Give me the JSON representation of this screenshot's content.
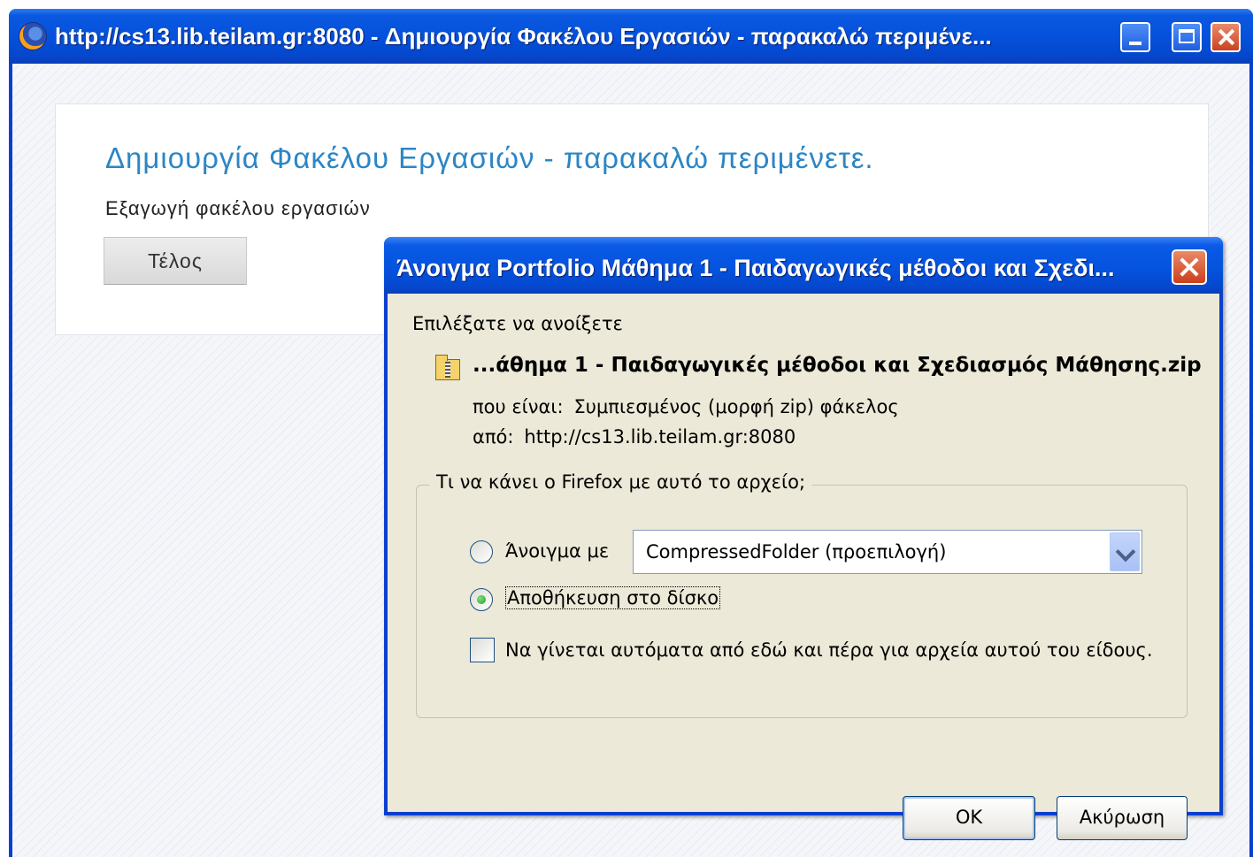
{
  "window": {
    "title": "http://cs13.lib.teilam.gr:8080 - Δημιουργία Φακέλου Εργασιών - παρακαλώ περιμένε...",
    "icon": "firefox-icon"
  },
  "page": {
    "heading": "Δημιουργία Φακέλου Εργασιών - παρακαλώ περιμένετε.",
    "subtext": "Εξαγωγή φακέλου εργασιών",
    "finish_button": "Τέλος"
  },
  "dialog": {
    "title": "Άνοιγμα Portfolio Μάθημα 1 - Παιδαγωγικές μέθοδοι και Σχεδι...",
    "choose_label": "Επιλέξατε να ανοίξετε",
    "file_name": "...άθημα 1 - Παιδαγωγικές μέθοδοι και Σχεδιασμός Μάθησης.zip",
    "type_key": "που είναι:",
    "type_value": "Συμπιεσμένος (μορφή zip) φάκελος",
    "from_key": "από:",
    "from_value": "http://cs13.lib.teilam.gr:8080",
    "group_legend": "Τι να κάνει ο Firefox  με αυτό το αρχείο;",
    "open_with_label": "Άνοιγμα με",
    "open_with_value": "CompressedFolder (προεπιλογή)",
    "save_label": "Αποθήκευση στο δίσκο",
    "selected_option": "save",
    "auto_label": "Να γίνεται αυτόματα από εδώ και πέρα για αρχεία αυτού του είδους.",
    "auto_checked": false,
    "ok_button": "OK",
    "cancel_button": "Ακύρωση"
  }
}
